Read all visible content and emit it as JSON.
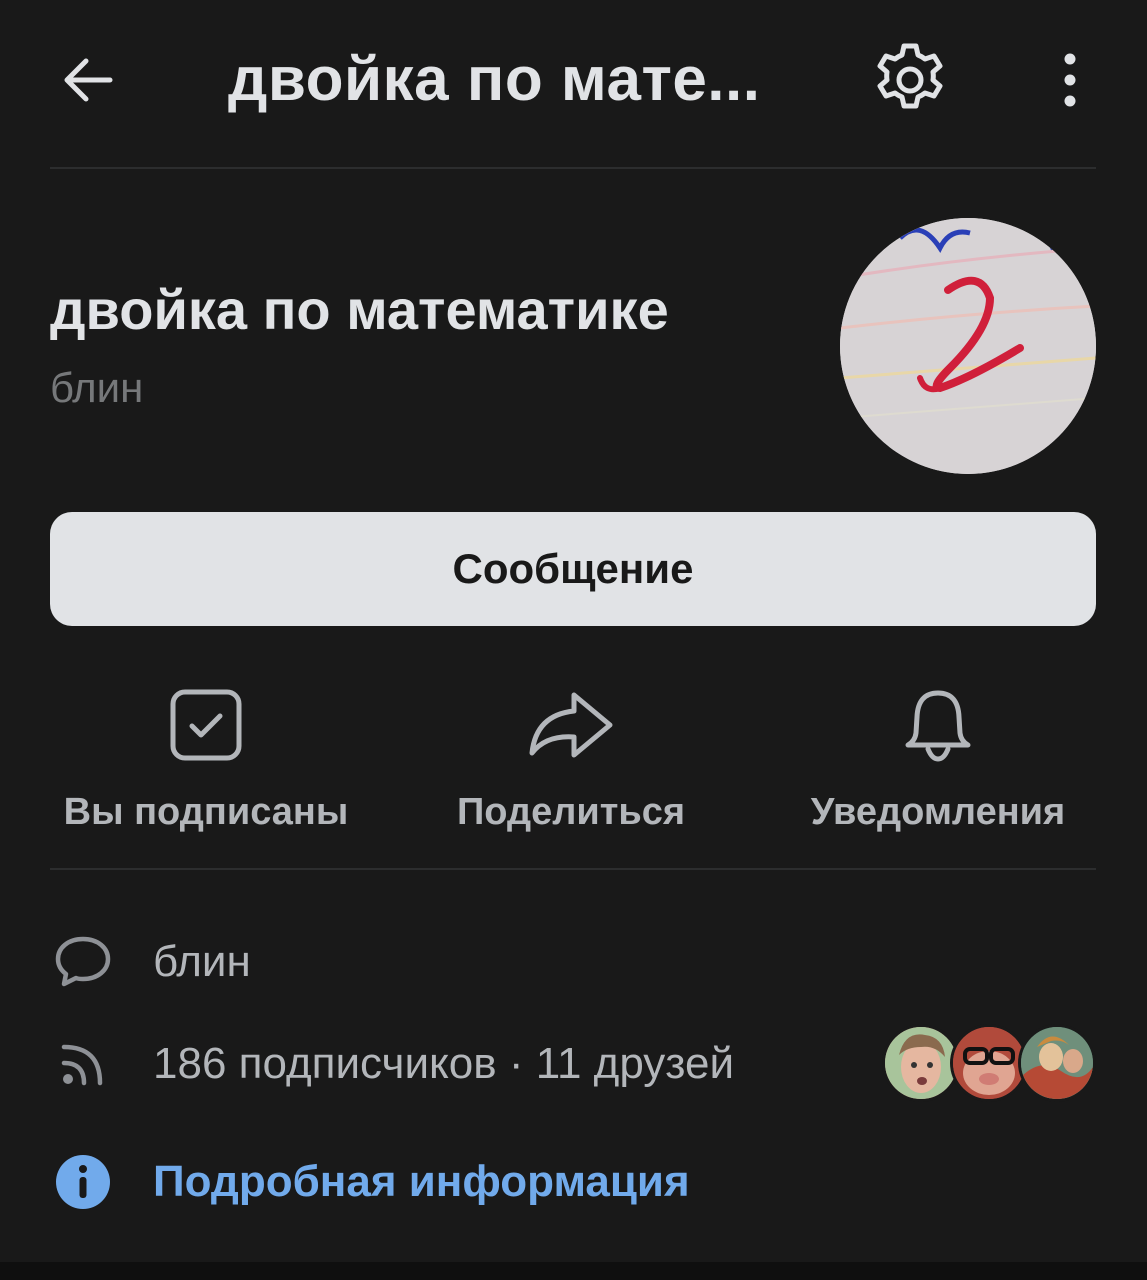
{
  "header": {
    "title": "двойка по мате...",
    "back_icon": "arrow-left-icon",
    "settings_icon": "gear-icon",
    "more_icon": "more-vertical-icon"
  },
  "profile": {
    "name": "двойка по математике",
    "status": "блин",
    "avatar_icon": "avatar-photo"
  },
  "message_button": {
    "label": "Сообщение"
  },
  "actions": [
    {
      "label": "Вы подписаны",
      "icon": "checkbox-checked-icon"
    },
    {
      "label": "Поделиться",
      "icon": "share-arrow-icon"
    },
    {
      "label": "Уведомления",
      "icon": "bell-icon"
    }
  ],
  "info": {
    "status_text": "блин",
    "followers_text": "186 подписчиков · 11 друзей",
    "details_link": "Подробная информация"
  },
  "colors": {
    "background": "#191919",
    "text_primary": "#e1e3e6",
    "text_secondary": "#b3b6ba",
    "accent": "#71aaeb",
    "button_bg": "#e1e3e6"
  }
}
